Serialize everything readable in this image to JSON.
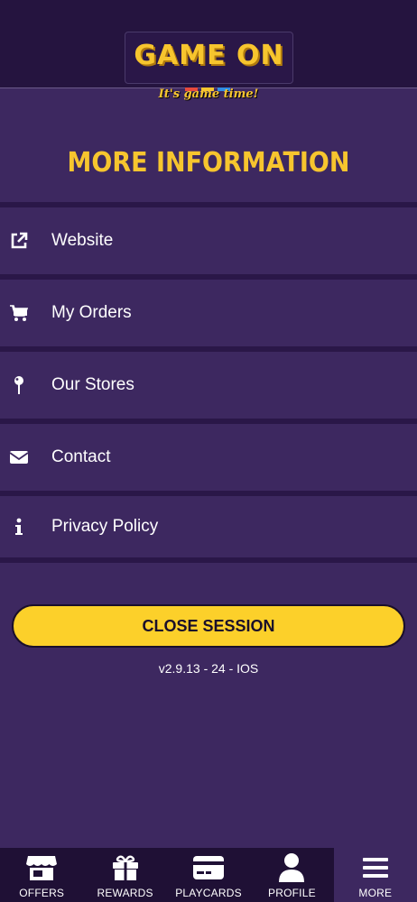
{
  "header": {
    "logo_text": "GAME ON",
    "tagline": "It's game time!",
    "logo_colors": [
      "#e84a3c",
      "#f7c52e",
      "#2f8de4"
    ]
  },
  "page": {
    "title": "MORE INFORMATION"
  },
  "menu": {
    "items": [
      {
        "label": "Website",
        "icon": "external-link-icon"
      },
      {
        "label": "My Orders",
        "icon": "cart-icon"
      },
      {
        "label": "Our Stores",
        "icon": "map-pin-icon"
      },
      {
        "label": "Contact",
        "icon": "envelope-icon"
      },
      {
        "label": "Privacy Policy",
        "icon": "info-icon"
      }
    ]
  },
  "actions": {
    "close_session_label": "CLOSE SESSION"
  },
  "footer": {
    "version": "v2.9.13 - 24 - IOS"
  },
  "tabbar": {
    "tabs": [
      {
        "label": "OFFERS",
        "icon": "store-icon"
      },
      {
        "label": "REWARDS",
        "icon": "gift-icon"
      },
      {
        "label": "PLAYCARDS",
        "icon": "card-icon"
      },
      {
        "label": "PROFILE",
        "icon": "user-icon"
      },
      {
        "label": "MORE",
        "icon": "menu-icon"
      }
    ],
    "active": "MORE"
  },
  "colors": {
    "background": "#3d2860",
    "header": "#25143f",
    "accent": "#f7c52e",
    "button": "#fcd02a"
  }
}
